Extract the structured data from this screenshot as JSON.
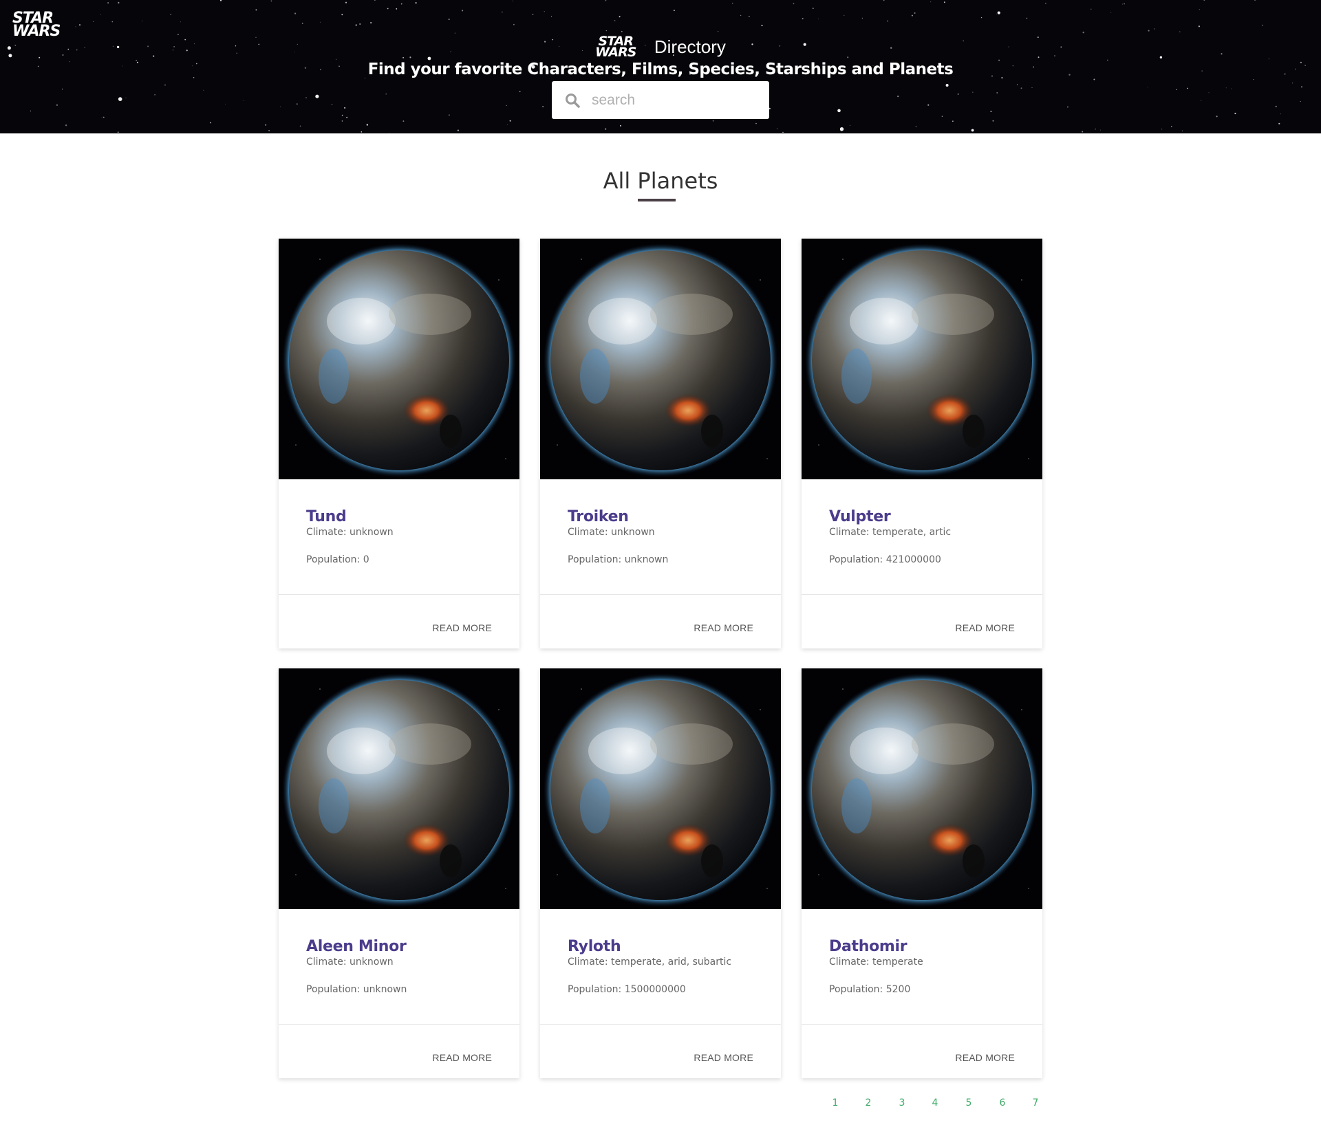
{
  "header": {
    "corner_logo": [
      "STAR",
      "WARS"
    ],
    "title_logo": [
      "STAR",
      "WARS"
    ],
    "title": "Directory",
    "subtitle": "Find your favorite Characters, Films, Species, Starships and Planets"
  },
  "search": {
    "placeholder": "search",
    "icon": "search-icon"
  },
  "section": {
    "title": "All Planets"
  },
  "planets": [
    {
      "name": "Tund",
      "climate": "Climate: unknown",
      "population": "Population: 0",
      "read_more": "READ MORE"
    },
    {
      "name": "Troiken",
      "climate": "Climate: unknown",
      "population": "Population: unknown",
      "read_more": "READ MORE"
    },
    {
      "name": "Vulpter",
      "climate": "Climate: temperate, artic",
      "population": "Population: 421000000",
      "read_more": "READ MORE"
    },
    {
      "name": "Aleen Minor",
      "climate": "Climate: unknown",
      "population": "Population: unknown",
      "read_more": "READ MORE"
    },
    {
      "name": "Ryloth",
      "climate": "Climate: temperate, arid, subartic",
      "population": "Population: 1500000000",
      "read_more": "READ MORE"
    },
    {
      "name": "Dathomir",
      "climate": "Climate: temperate",
      "population": "Population: 5200",
      "read_more": "READ MORE"
    }
  ],
  "pagination": [
    "1",
    "2",
    "3",
    "4",
    "5",
    "6",
    "7"
  ],
  "colors": {
    "planet_name": "#4b3c8c",
    "pagination": "#3faa68",
    "title_underline": "#4a3f45",
    "header_bg": "#06050a"
  }
}
